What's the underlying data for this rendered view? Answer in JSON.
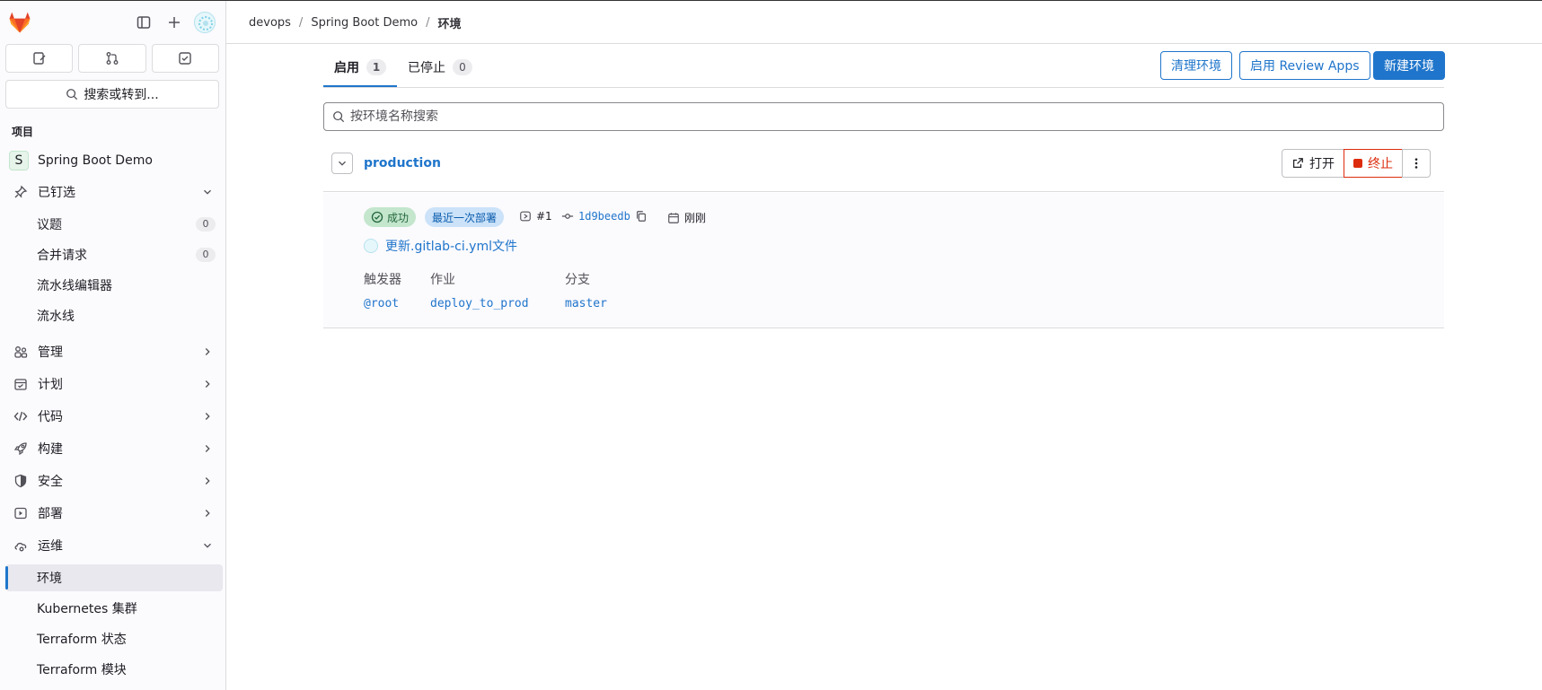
{
  "sidebar": {
    "search_label": "搜索或转到...",
    "section_title": "项目",
    "project_name": "Spring Boot Demo",
    "project_initial": "S",
    "pinned": {
      "label": "已钉选",
      "items": [
        {
          "label": "议题",
          "count": "0"
        },
        {
          "label": "合并请求",
          "count": "0"
        },
        {
          "label": "流水线编辑器"
        },
        {
          "label": "流水线"
        }
      ]
    },
    "groups": [
      {
        "label": "管理"
      },
      {
        "label": "计划"
      },
      {
        "label": "代码"
      },
      {
        "label": "构建"
      },
      {
        "label": "安全"
      },
      {
        "label": "部署"
      }
    ],
    "operate": {
      "label": "运维",
      "items": [
        {
          "label": "环境"
        },
        {
          "label": "Kubernetes 集群"
        },
        {
          "label": "Terraform 状态"
        },
        {
          "label": "Terraform 模块"
        }
      ]
    }
  },
  "breadcrumb": {
    "items": [
      "devops",
      "Spring Boot Demo",
      "环境"
    ]
  },
  "tabs": [
    {
      "label": "启用",
      "count": "1"
    },
    {
      "label": "已停止",
      "count": "0"
    }
  ],
  "actions": {
    "clean": "清理环境",
    "review_apps": "启用 Review Apps",
    "new_env": "新建环境"
  },
  "search": {
    "placeholder": "按环境名称搜索"
  },
  "environment": {
    "name": "production",
    "open_label": "打开",
    "stop_label": "终止",
    "status": "成功",
    "latest_badge": "最近一次部署",
    "deployment_id": "#1",
    "commit_sha": "1d9beedb",
    "time": "刚刚",
    "commit_title": "更新.gitlab-ci.yml文件",
    "columns": [
      {
        "header": "触发器",
        "value": "@root"
      },
      {
        "header": "作业",
        "value": "deploy_to_prod"
      },
      {
        "header": "分支",
        "value": "master"
      }
    ]
  },
  "colors": {
    "brand": "#1f75cb",
    "danger": "#dd2b0e",
    "success": "#24663b"
  }
}
